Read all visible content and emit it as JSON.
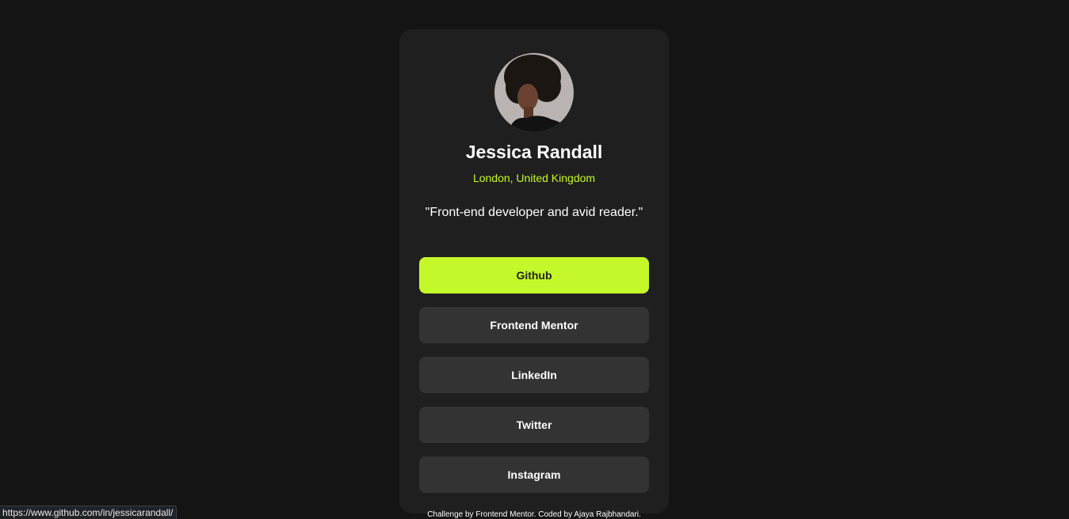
{
  "profile": {
    "name": "Jessica Randall",
    "location": "London, United Kingdom",
    "bio": "\"Front-end developer and avid reader.\""
  },
  "links": [
    {
      "label": "Github",
      "active": true
    },
    {
      "label": "Frontend Mentor",
      "active": false
    },
    {
      "label": "LinkedIn",
      "active": false
    },
    {
      "label": "Twitter",
      "active": false
    },
    {
      "label": "Instagram",
      "active": false
    }
  ],
  "footer": {
    "attribution": "Challenge by Frontend Mentor. Coded by Ajaya Rajbhandari."
  },
  "status_bar": {
    "url": "https://www.github.com/in/jessicarandall/"
  },
  "colors": {
    "page_background": "#141414",
    "card_background": "#1f1f1f",
    "accent": "#c4f82a",
    "button_background": "#333333"
  }
}
